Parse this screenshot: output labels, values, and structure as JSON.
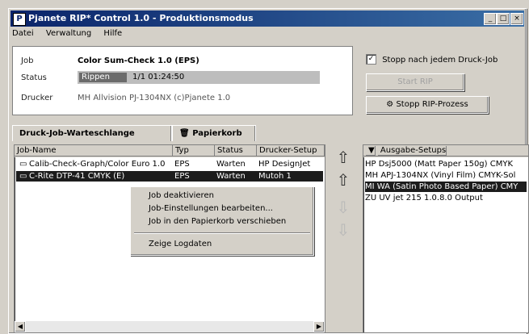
{
  "window": {
    "title": "Pjanete RIP* Control 1.0 - Produktionsmodus",
    "min": "_",
    "max": "□",
    "close": "×"
  },
  "menu": [
    "Datei",
    "Verwaltung",
    "Hilfe"
  ],
  "info": {
    "job_label": "Job",
    "job_value": "Color Sum-Check 1.0 (EPS)",
    "status_label": "Status",
    "status_state": "Rippen",
    "status_value": "1/1 01:24:50",
    "printer_label": "Drucker",
    "printer_value": "MH Allvision PJ-1304NX (c)Pjanete 1.0"
  },
  "options": {
    "stop_after_job_checked": true,
    "stop_after_job_label": "Stopp nach jedem Druck-Job",
    "disabled_button_label": "Start RIP",
    "stop_rip_label": "Stopp RIP-Prozess"
  },
  "tabs": [
    "Druck-Job-Warteschlange",
    "Papierkorb"
  ],
  "joblist": {
    "columns": [
      "Job-Name",
      "Typ",
      "Status",
      "Drucker-Setup"
    ],
    "rows": [
      {
        "name": "Calib-Check-Graph/Color Euro 1.0",
        "type": "EPS",
        "status": "Warten",
        "setup": "HP DesignJet"
      },
      {
        "name": "C-Rite DTP-41 CMYK (E)",
        "type": "EPS",
        "status": "Warten",
        "setup": "Mutoh 1"
      }
    ]
  },
  "context_menu": [
    "Job deaktivieren",
    "Job-Einstellungen bearbeiten...",
    "Job in den Papierkorb verschieben",
    "Zeige Logdaten"
  ],
  "right_panel": {
    "header": "Ausgabe-Setups",
    "items": [
      "HP Dsj5000 (Matt Paper 150g) CMYK",
      "MH APJ-1304NX (Vinyl Film) CMYK-Sol",
      "MI WA (Satin Photo Based Paper) CMY",
      "ZU UV jet 215 1.0.8.0 Output"
    ]
  }
}
